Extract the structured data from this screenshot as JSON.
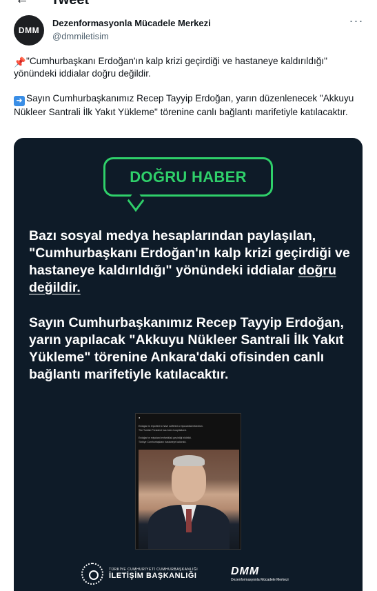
{
  "header": {
    "back_icon": "arrow-left-icon",
    "title": "Tweet"
  },
  "author": {
    "avatar_text": "DMM",
    "name": "Dezenformasyonla Mücadele Merkezi",
    "handle": "@dmmiletisim"
  },
  "tweet": {
    "paragraph1": "\"Cumhurbaşkanı Erdoğan'ın kalp krizi geçirdiği ve hastaneye kaldırıldığı\" yönündeki iddialar doğru değildir.",
    "paragraph2": "Sayın Cumhurbaşkanımız Recep Tayyip Erdoğan, yarın düzenlenecek \"Akkuyu Nükleer Santrali İlk Yakıt Yükleme\" törenine canlı bağlantı marifetiyle katılacaktır."
  },
  "media": {
    "badge": "DOĞRU HABER",
    "claim_part1": "Bazı sosyal medya hesaplarından paylaşılan, \"Cumhurbaşkanı Erdoğan'ın kalp krizi geçirdiği ve hastaneye kaldırıldığı\" yönündeki iddialar ",
    "claim_underlined": "doğru değildir.",
    "statement": "Sayın Cumhurbaşkanımız Recep Tayyip Erdoğan, yarın yapılacak \"Akkuyu Nükleer Santrali İlk Yakıt Yükleme\" törenine Ankara'daki ofisinden canlı bağlantı marifetiyle katılacaktır.",
    "embedded_tweet": {
      "line1": "Erdogan is reported to have suffered a myocardial infarction.",
      "line2": "The Turkish President has been hospitalized.",
      "line3": "Erdoğan'ın miyokard enfarktüsü geçirdiği bildirildi.",
      "line4": "Türkiye Cumhurbaşkanı hastaneye kaldırıldı."
    },
    "footer_left_small": "TÜRKİYE CUMHURİYETİ CUMHURBAŞKANLIĞI",
    "footer_left_big": "İLETİŞİM BAŞKANLIĞI",
    "footer_right_logo": "DMM",
    "footer_right_sub": "Dezenformasyonla Mücadele Merkezi"
  },
  "colors": {
    "accent_green": "#2fd06a",
    "media_bg": "#0e1b28"
  }
}
